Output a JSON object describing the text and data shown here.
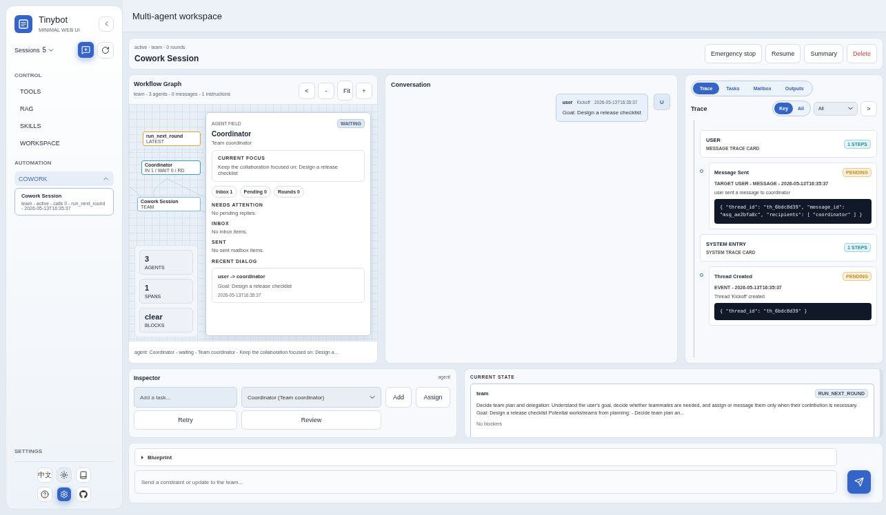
{
  "sidebar": {
    "app_title": "Tinybot",
    "app_subtitle": "MINIMAL WEB UI",
    "sessions_label": "Sessions",
    "sessions_count": "5",
    "sections": [
      {
        "label": "CONTROL",
        "items": [
          {
            "label": "TOOLS"
          },
          {
            "label": "RAG"
          },
          {
            "label": "SKILLS"
          },
          {
            "label": "WORKSPACE"
          }
        ]
      },
      {
        "label": "AUTOMATION",
        "groups": [
          {
            "label": "COWORK",
            "expanded": true,
            "sessions": [
              {
                "title": "Cowork Session",
                "meta": "team - active - calls 0 - run_next_round - 2026-05-13T16:35:37",
                "selected": true
              }
            ]
          }
        ]
      }
    ],
    "settings_label": "SETTINGS",
    "settings_buttons": [
      {
        "kind": "language",
        "label": "中文",
        "selected": false
      },
      {
        "kind": "theme",
        "selected": false
      },
      {
        "kind": "docs",
        "selected": false
      },
      {
        "kind": "help",
        "selected": false
      },
      {
        "kind": "settings",
        "selected": true
      },
      {
        "kind": "github",
        "selected": false
      }
    ]
  },
  "header": {
    "title": "Multi-agent workspace"
  },
  "session": {
    "meta": "active · team · 0 rounds",
    "title": "Cowork Session",
    "actions": [
      {
        "label": "Emergency stop",
        "kind": "normal"
      },
      {
        "label": "Resume",
        "kind": "normal"
      },
      {
        "label": "Summary",
        "kind": "normal"
      },
      {
        "label": "Delete",
        "kind": "danger"
      }
    ]
  },
  "workflow": {
    "title": "Workflow Graph",
    "subtitle": "team - 3 agents - 0 messages - 1 instructions",
    "controls": [
      "<",
      "-",
      "Fit",
      "+"
    ],
    "nodes": [
      {
        "title": "run_next_round",
        "subtitle": "LATEST",
        "kind": "round"
      },
      {
        "title": "Coordinator",
        "subtitle": "IN 1 / WAIT 0 / RD",
        "kind": "agent"
      },
      {
        "title": "Cowork Session",
        "subtitle": "TEAM",
        "kind": "session"
      }
    ],
    "stats": [
      {
        "value": "3",
        "label": "AGENTS"
      },
      {
        "value": "1",
        "label": "SPANS"
      },
      {
        "value": "clear",
        "label": "BLOCKS"
      }
    ],
    "agent_panel": {
      "section": "AGENT FIELD",
      "status": "WAITING",
      "name": "Coordinator",
      "role": "Team coordinator",
      "focus_label": "CURRENT FOCUS",
      "focus_text": "Keep the collaboration focused on: Design a release checklist",
      "chips": [
        "Inbox 1",
        "Pending 0",
        "Rounds 0"
      ],
      "sections": [
        {
          "heading": "NEEDS ATTENTION",
          "text": "No pending replies."
        },
        {
          "heading": "INBOX",
          "text": "No inbox items."
        },
        {
          "heading": "SENT",
          "text": "No sent mailbox items."
        }
      ],
      "dialog_heading": "RECENT DIALOG",
      "dialog": {
        "title": "user -> coordinator",
        "text": "Goal: Design a release checklist",
        "time": "2026-05-13T16:35:37"
      }
    },
    "footer": "agent: Coordinator - waiting - Team coordinator - Keep the collaboration focused on: Design a..."
  },
  "conversation": {
    "title": "Conversation",
    "messages": [
      {
        "author": "user",
        "thread": "Kickoff",
        "time": "2026-05-13T16:35:37",
        "text": "Goal: Design a release checklist",
        "avatar": "U"
      }
    ]
  },
  "trace": {
    "tabs": [
      {
        "label": "Trace",
        "selected": true
      },
      {
        "label": "Tasks",
        "selected": false
      },
      {
        "label": "Mailbox",
        "selected": false
      },
      {
        "label": "Outputs",
        "selected": false
      }
    ],
    "title": "Trace",
    "filters": [
      {
        "label": "Key",
        "selected": true
      },
      {
        "label": "All",
        "selected": false
      }
    ],
    "select": "All",
    "next": ">",
    "groups": [
      {
        "title": "USER",
        "subtitle": "MESSAGE TRACE CARD",
        "steps": "1 STEPS",
        "events": [
          {
            "title": "Message Sent",
            "status": "PENDING",
            "meta": "TARGET USER - MESSAGE - 2026-05-13T16:35:37",
            "text": "user sent a message to coordinator",
            "code": "{ \"thread_id\": \"th_6bdc8d39\", \"message_id\": \"msg_ae2bfa8c\", \"recipients\": [ \"coordinator\" ] }"
          }
        ]
      },
      {
        "title": "SYSTEM ENTRY",
        "subtitle": "SYSTEM TRACE CARD",
        "steps": "1 STEPS",
        "events": [
          {
            "title": "Thread Created",
            "status": "PENDING",
            "meta": "EVENT - 2026-05-13T16:35:37",
            "text": "Thread 'Kickoff' created",
            "code": "{ \"thread_id\": \"th_6bdc8d39\" }"
          }
        ]
      }
    ]
  },
  "inspector": {
    "title": "Inspector",
    "tag": "agent",
    "task_placeholder": "Add a task...",
    "assignee": "Coordinator (Team coordinator)",
    "buttons": [
      "Add",
      "Assign"
    ],
    "actions": [
      "Retry",
      "Review"
    ]
  },
  "current_state": {
    "heading": "CURRENT STATE",
    "card": {
      "name": "team",
      "badge": "RUN_NEXT_ROUND",
      "text": "Decide team plan and delegation: Understand the user's goal, decide whether teammates are needed, and assign or message them only when their contribution is necessary. Goal: Design a release checklist Potential workstreams from planning: - Decide team plan an...",
      "note": "No blockers"
    }
  },
  "composer": {
    "blueprint": {
      "label": "Blueprint",
      "expanded": false
    },
    "placeholder": "Send a constraint or update to the team..."
  }
}
